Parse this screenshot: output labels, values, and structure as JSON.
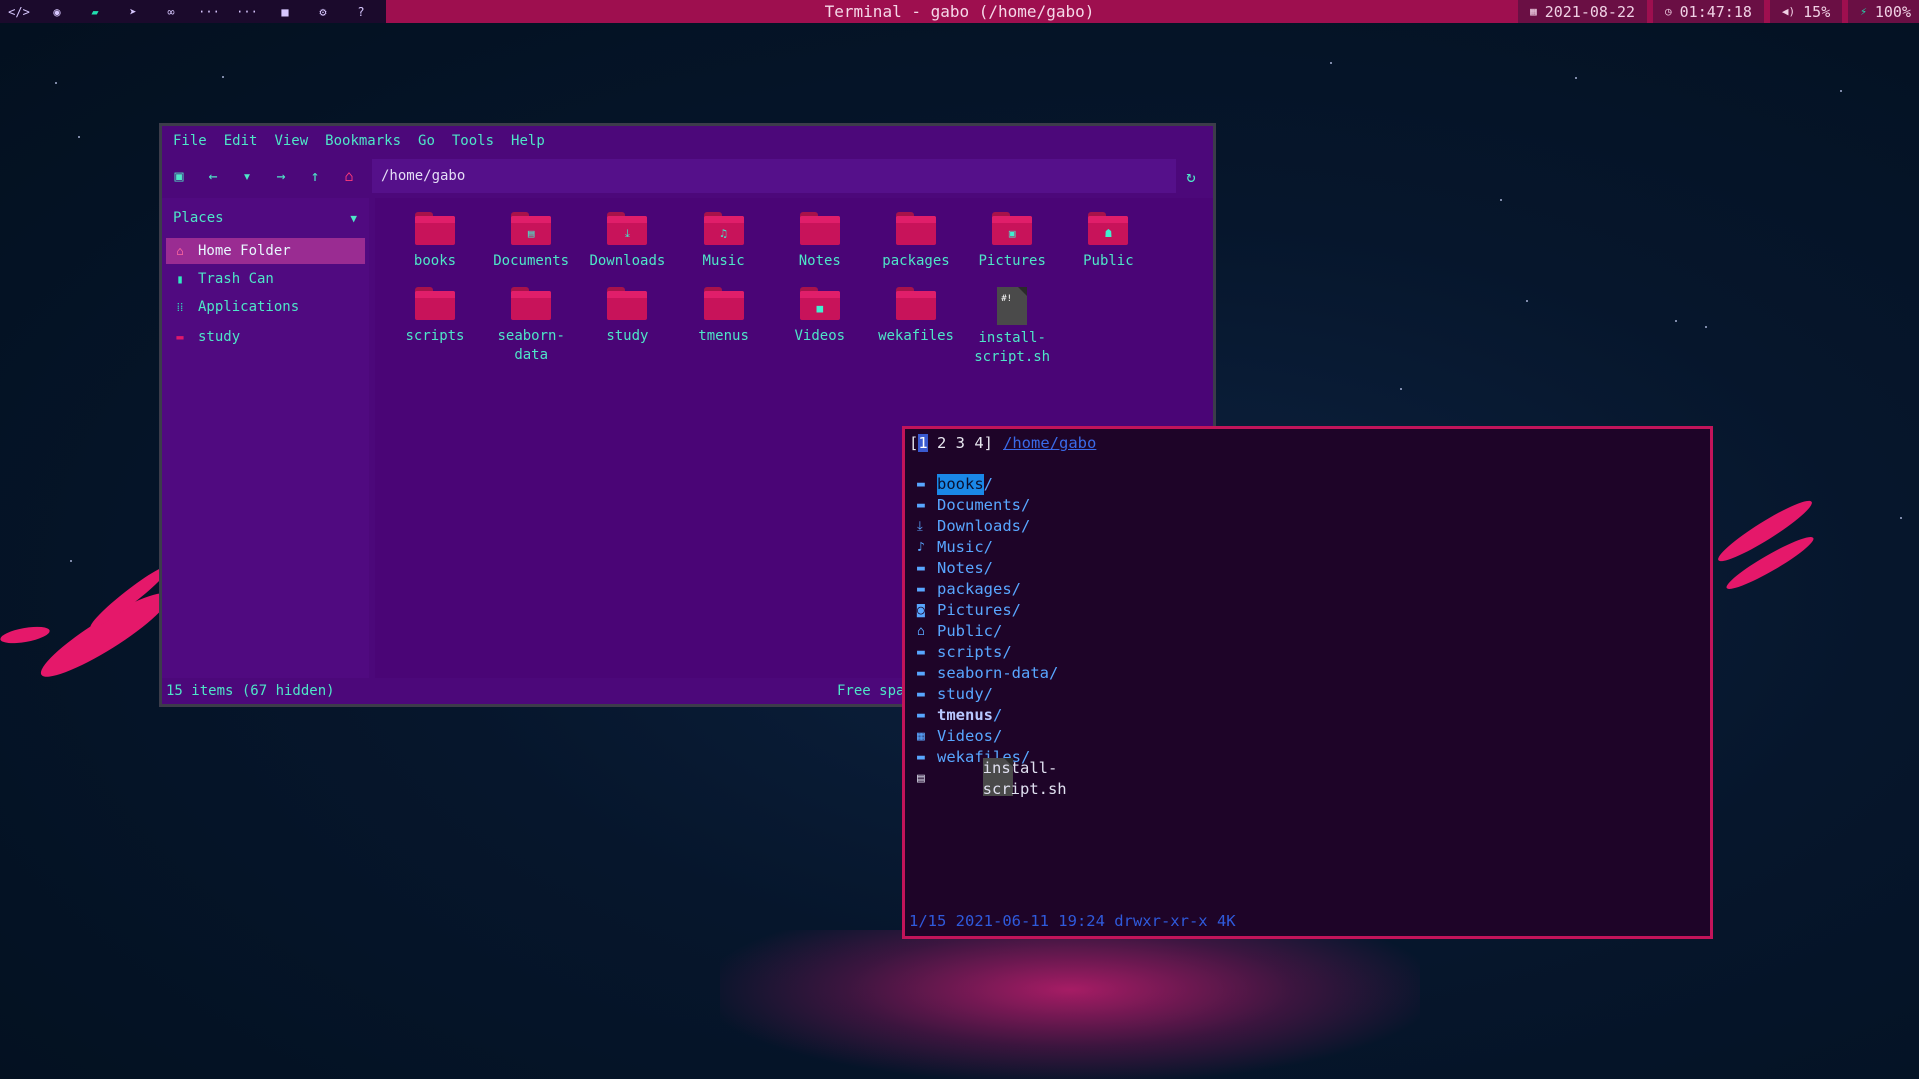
{
  "topbar": {
    "title": "Terminal - gabo (/home/gabo)",
    "date": "2021-08-22",
    "time": "01:47:18",
    "volume": "15%",
    "battery": "100%"
  },
  "filemanager": {
    "menu": [
      "File",
      "Edit",
      "View",
      "Bookmarks",
      "Go",
      "Tools",
      "Help"
    ],
    "path": "/home/gabo",
    "places_label": "Places",
    "sidebar": [
      {
        "label": "Home Folder",
        "icon": "home-icon",
        "selected": true
      },
      {
        "label": "Trash Can",
        "icon": "trash-icon",
        "selected": false
      },
      {
        "label": "Applications",
        "icon": "apps-grid-icon",
        "selected": false
      },
      {
        "label": "study",
        "icon": "folder-icon",
        "selected": false
      }
    ],
    "items": [
      {
        "label": "books",
        "icon": "folder-icon"
      },
      {
        "label": "Documents",
        "icon": "documents-folder-icon"
      },
      {
        "label": "Downloads",
        "icon": "downloads-folder-icon"
      },
      {
        "label": "Music",
        "icon": "music-folder-icon"
      },
      {
        "label": "Notes",
        "icon": "folder-icon"
      },
      {
        "label": "packages",
        "icon": "folder-icon"
      },
      {
        "label": "Pictures",
        "icon": "pictures-folder-icon"
      },
      {
        "label": "Public",
        "icon": "public-folder-icon"
      },
      {
        "label": "scripts",
        "icon": "folder-icon"
      },
      {
        "label": "seaborn-\ndata",
        "icon": "folder-icon"
      },
      {
        "label": "study",
        "icon": "folder-icon"
      },
      {
        "label": "tmenus",
        "icon": "folder-icon"
      },
      {
        "label": "Videos",
        "icon": "videos-folder-icon"
      },
      {
        "label": "wekafiles",
        "icon": "folder-icon"
      },
      {
        "label": "install-\nscript.sh",
        "icon": "script-file-icon"
      }
    ],
    "status_left": "15 items (67 hidden)",
    "status_right": "Free spa"
  },
  "terminal": {
    "tabs_prefix": "[",
    "tab_current": "1",
    "tabs_rest": " 2 3 4]",
    "path": "/home/gabo",
    "entries": [
      {
        "name": "books",
        "suffix": "/",
        "icon": "folder-icon",
        "style": "hl"
      },
      {
        "name": "Documents",
        "suffix": "/",
        "icon": "folder-icon",
        "style": ""
      },
      {
        "name": "Downloads",
        "suffix": "/",
        "icon": "download-icon",
        "style": ""
      },
      {
        "name": "Music",
        "suffix": "/",
        "icon": "music-note-icon",
        "style": ""
      },
      {
        "name": "Notes",
        "suffix": "/",
        "icon": "folder-icon",
        "style": ""
      },
      {
        "name": "packages",
        "suffix": "/",
        "icon": "folder-icon",
        "style": ""
      },
      {
        "name": "Pictures",
        "suffix": "/",
        "icon": "camera-icon",
        "style": ""
      },
      {
        "name": "Public",
        "suffix": "/",
        "icon": "inbox-icon",
        "style": ""
      },
      {
        "name": "scripts",
        "suffix": "/",
        "icon": "folder-icon",
        "style": ""
      },
      {
        "name": "seaborn-data",
        "suffix": "/",
        "icon": "folder-icon",
        "style": ""
      },
      {
        "name": "study",
        "suffix": "/",
        "icon": "folder-icon",
        "style": ""
      },
      {
        "name": "tmenus",
        "suffix": "/",
        "icon": "folder-icon",
        "style": "bold"
      },
      {
        "name": "Videos",
        "suffix": "/",
        "icon": "film-icon",
        "style": ""
      },
      {
        "name": "wekafiles",
        "suffix": "/",
        "icon": "folder-icon",
        "style": ""
      },
      {
        "name": "install-script.sh",
        "suffix": "",
        "icon": "script-file-icon",
        "style": "file"
      }
    ],
    "footer": "1/15 2021-06-11 19:24 drwxr-xr-x 4K"
  }
}
